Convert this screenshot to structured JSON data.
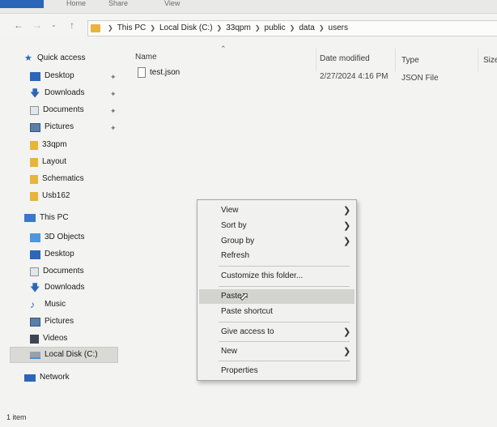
{
  "ribbon": {
    "tabs": [
      "Home",
      "Share",
      "View"
    ]
  },
  "address": {
    "crumbs": [
      "This PC",
      "Local Disk (C:)",
      "33qpm",
      "public",
      "data",
      "users"
    ]
  },
  "nav": {
    "quick_access": "Quick access",
    "quick_items": [
      "Desktop",
      "Downloads",
      "Documents",
      "Pictures",
      "33qpm",
      "Layout",
      "Schematics",
      "Usb162"
    ],
    "this_pc": "This PC",
    "pc_items": [
      "3D Objects",
      "Desktop",
      "Documents",
      "Downloads",
      "Music",
      "Pictures",
      "Videos",
      "Local Disk (C:)"
    ],
    "network": "Network"
  },
  "columns": {
    "name": "Name",
    "date": "Date modified",
    "type": "Type",
    "size": "Size"
  },
  "files": [
    {
      "name": "test.json",
      "date": "2/27/2024 4:16 PM",
      "type": "JSON File"
    }
  ],
  "status": {
    "count": "1 item"
  },
  "context_menu": {
    "view": "View",
    "sort_by": "Sort by",
    "group_by": "Group by",
    "refresh": "Refresh",
    "customize": "Customize this folder...",
    "paste": "Paste",
    "paste_shortcut": "Paste shortcut",
    "give_access": "Give access to",
    "new": "New",
    "properties": "Properties"
  },
  "colors": {
    "folder": "#e7b43c",
    "blue": "#2c66b8",
    "selection": "#d9d9d6"
  }
}
